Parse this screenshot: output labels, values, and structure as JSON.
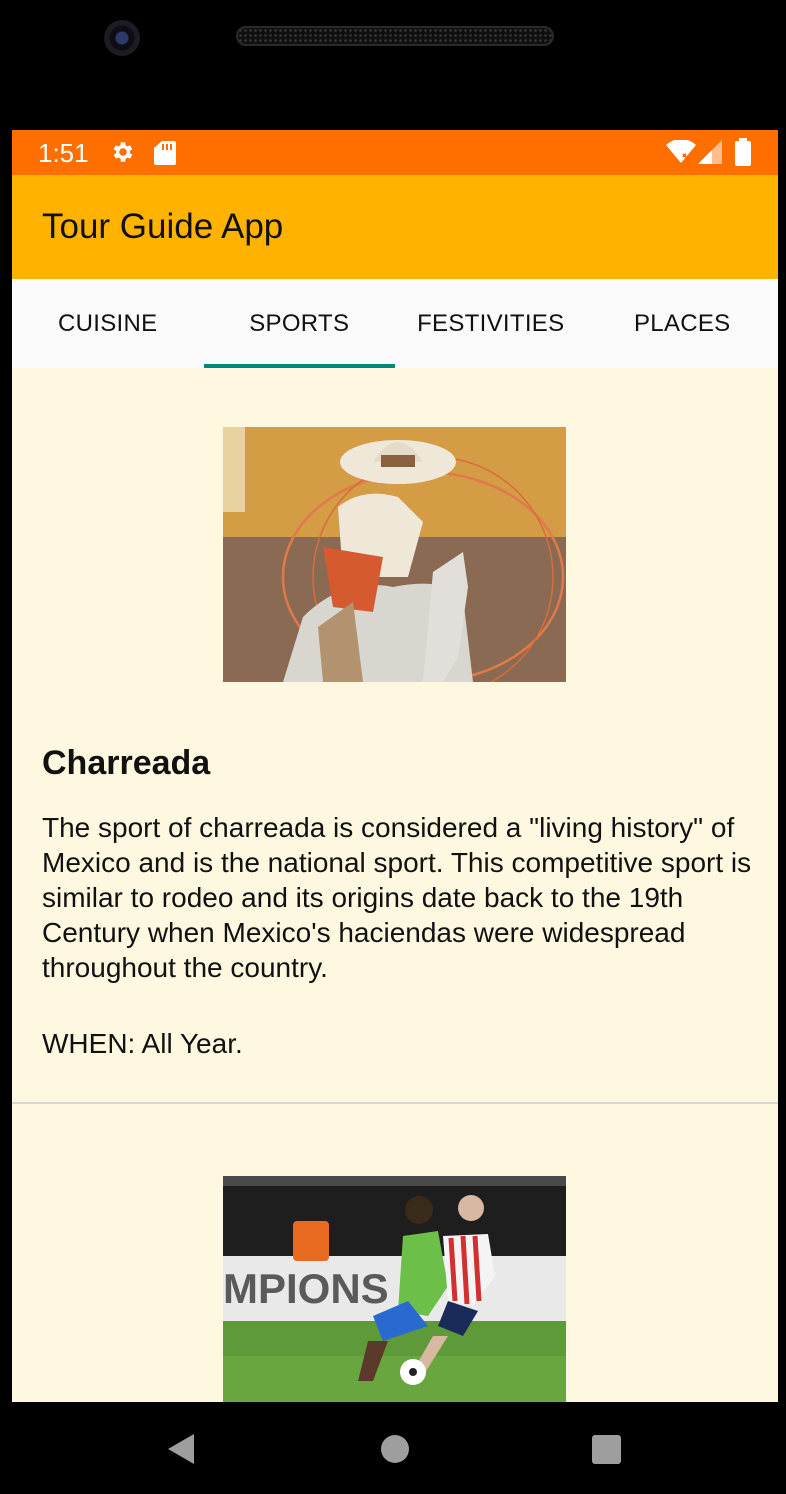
{
  "status_bar": {
    "time": "1:51",
    "icons": [
      "gear-icon",
      "sd-card-icon",
      "wifi-icon",
      "signal-icon",
      "battery-icon"
    ],
    "color": "#FF6F00"
  },
  "app_bar": {
    "title": "Tour Guide App",
    "color": "#FFB300"
  },
  "tabs": [
    {
      "label": "CUISINE",
      "selected": false
    },
    {
      "label": "SPORTS",
      "selected": true
    },
    {
      "label": "FESTIVITIES",
      "selected": false
    },
    {
      "label": "PLACES",
      "selected": false
    }
  ],
  "tab_indicator_color": "#00897B",
  "list": {
    "background": "#FFF8E1",
    "items": [
      {
        "image": "charreada-photo",
        "title": "Charreada",
        "description": "The sport of charreada is considered a \"living history\" of Mexico and is the national sport. This competitive sport is similar to rodeo and its origins date back to the 19th Century when Mexico's haciendas were widespread throughout the country.",
        "when": "WHEN: All Year."
      },
      {
        "image": "soccer-photo",
        "image_text": "MPIONS"
      }
    ]
  },
  "nav_bar": {
    "icons": [
      "back-icon",
      "home-icon",
      "recent-apps-icon"
    ]
  }
}
